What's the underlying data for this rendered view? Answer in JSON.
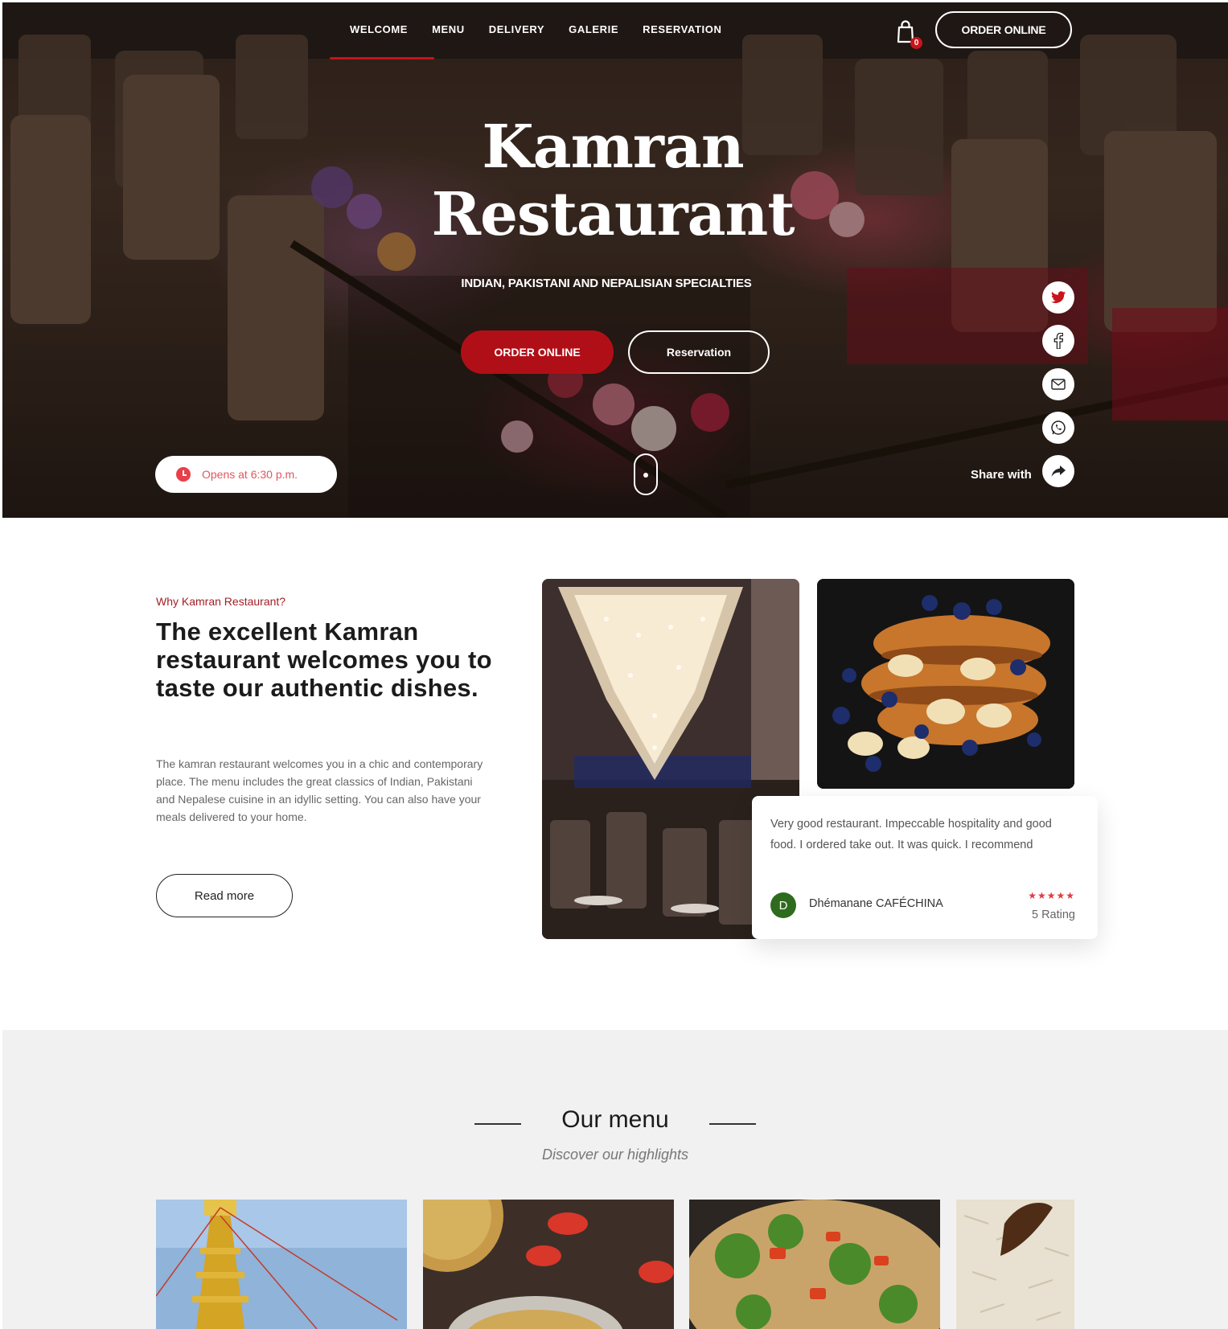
{
  "nav": {
    "items": [
      {
        "label": "WELCOME",
        "active": true
      },
      {
        "label": "MENU"
      },
      {
        "label": "DELIVERY"
      },
      {
        "label": "GALERIE"
      },
      {
        "label": "RESERVATION"
      }
    ],
    "cart_count": "0",
    "order_online": "ORDER ONLINE"
  },
  "hero": {
    "title_line1": "Kamran",
    "title_line2": "Restaurant",
    "subtitle": "INDIAN, PAKISTANI AND NEPALISIAN SPECIALTIES",
    "order_button": "ORDER ONLINE",
    "reservation_button": "Reservation",
    "opens": "Opens at 6:30 p.m.",
    "share_label": "Share with",
    "social_icons": [
      "twitter-icon",
      "facebook-icon",
      "email-icon",
      "whatsapp-icon",
      "share-icon"
    ]
  },
  "welcome": {
    "eyebrow": "Why Kamran Restaurant?",
    "title": "The excellent Kamran restaurant welcomes you to taste our authentic dishes.",
    "body": "The kamran restaurant welcomes you in a chic and contemporary place. The menu includes the great classics of Indian, Pakistani and Nepalese cuisine in an idyllic setting. You can also have your meals delivered to your home.",
    "read_more": "Read more"
  },
  "review": {
    "text": "Very good restaurant. Impeccable hospitality and good food. I ordered take out. It was quick. I recommend",
    "avatar_letter": "D",
    "author": "Dhémanane CAFÉCHINA",
    "stars": "★★★★★",
    "stars_value": 5,
    "rating_label": "5 Rating"
  },
  "menu": {
    "title": "Our menu",
    "subtitle": "Discover our highlights"
  },
  "colors": {
    "accent": "#b10f17",
    "accent_light": "#e23a45",
    "menu_bg": "#f1f1f1"
  }
}
